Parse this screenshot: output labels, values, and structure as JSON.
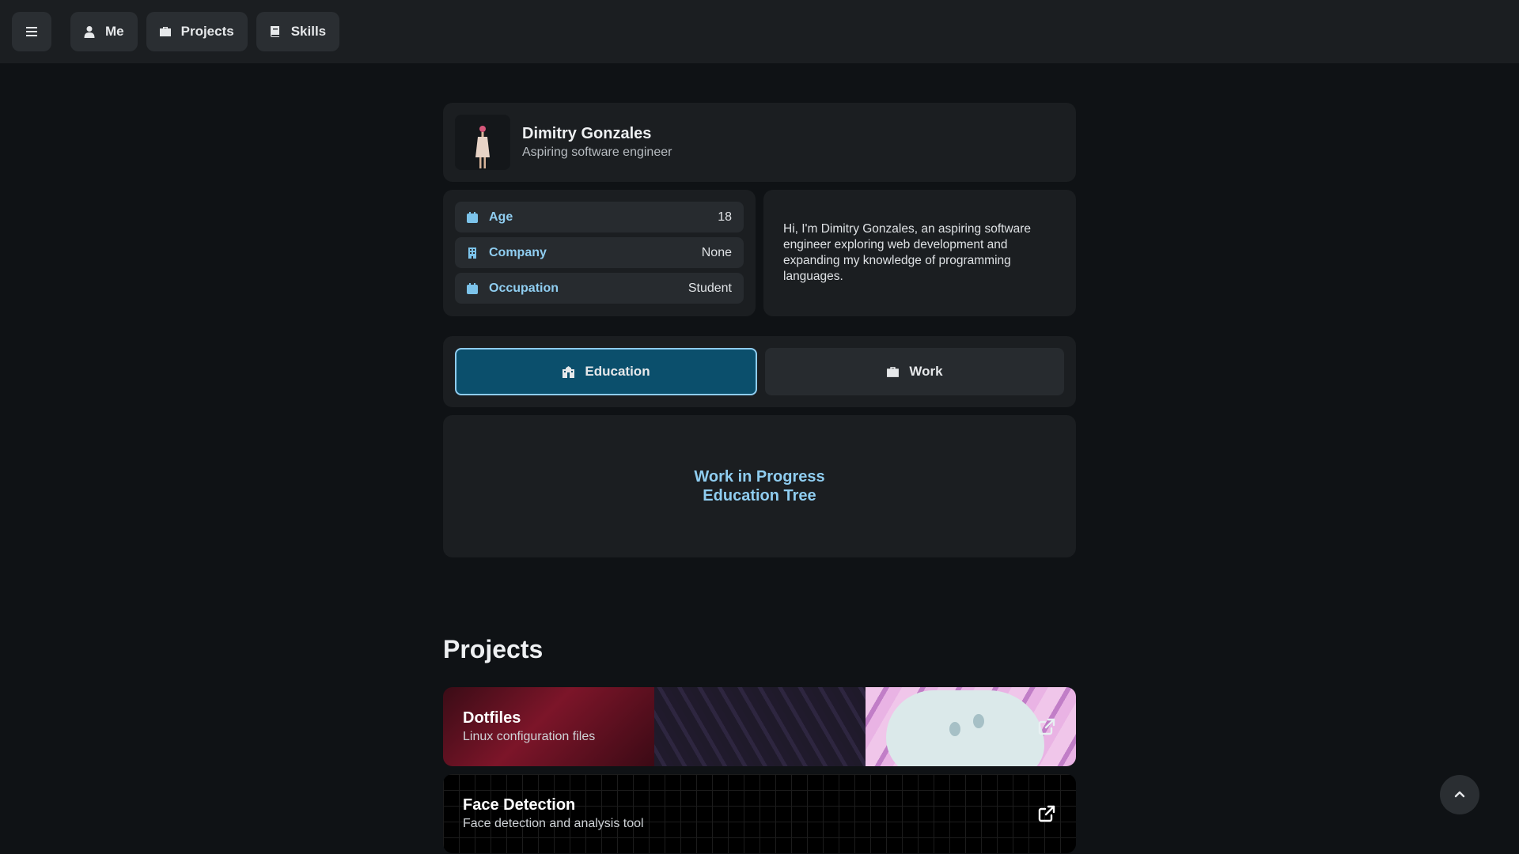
{
  "nav": {
    "menu_icon": "hamburger-icon",
    "items": [
      {
        "label": "Me",
        "icon": "user-icon"
      },
      {
        "label": "Projects",
        "icon": "briefcase-icon"
      },
      {
        "label": "Skills",
        "icon": "book-icon"
      }
    ]
  },
  "profile": {
    "name": "Dimitry Gonzales",
    "role": "Aspiring software engineer"
  },
  "info": [
    {
      "label": "Age",
      "value": "18",
      "icon": "calendar-icon"
    },
    {
      "label": "Company",
      "value": "None",
      "icon": "building-icon"
    },
    {
      "label": "Occupation",
      "value": "Student",
      "icon": "calendar-icon"
    }
  ],
  "bio": "Hi, I'm Dimitry Gonzales, an aspiring software engineer exploring web development and expanding my knowledge of programming languages.",
  "tabs": [
    {
      "label": "Education",
      "icon": "school-icon",
      "active": true
    },
    {
      "label": "Work",
      "icon": "briefcase-icon",
      "active": false
    }
  ],
  "wip": {
    "line1": "Work in Progress",
    "line2": "Education Tree"
  },
  "projects": {
    "title": "Projects",
    "items": [
      {
        "title": "Dotfiles",
        "desc": "Linux configuration files"
      },
      {
        "title": "Face Detection",
        "desc": "Face detection and analysis tool"
      }
    ]
  },
  "colors": {
    "background": "#0f1215",
    "card": "#1b1e21",
    "accent": "#8fcdf0",
    "active_tab": "#0b4f6c"
  }
}
